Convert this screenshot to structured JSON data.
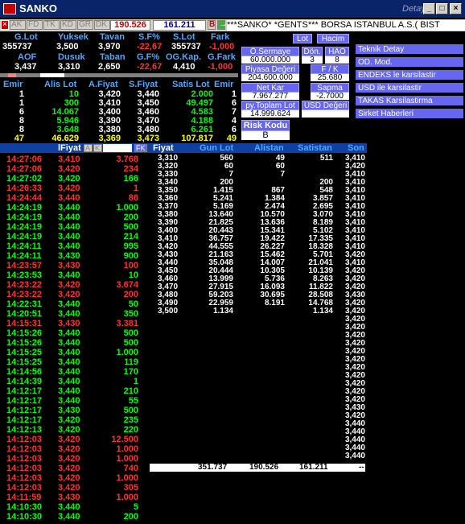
{
  "title": "SANKO",
  "detay": "Detay",
  "toolbar": {
    "tabs": [
      "AK",
      "FD",
      "TK",
      "KD",
      "GR",
      "DK"
    ],
    "price1": "190.526",
    "price2": "161.211",
    "b": "B",
    "ticker": "***SANKO* *GENTS*** BORSA ISTANBUL A.S.( BIST"
  },
  "top": {
    "h1": [
      "G.Lot",
      "Yuksek",
      "Tavan",
      "S.F%",
      "S.Lot",
      "Fark"
    ],
    "v1": [
      "355737",
      "3,500",
      "3,970",
      "-22,67",
      "355737",
      "-1,000"
    ],
    "h2": [
      "AOF",
      "Dusuk",
      "Taban",
      "G.F%",
      "OG.Kap.",
      "G.Fark"
    ],
    "v2": [
      "3,437",
      "3,310",
      "2,650",
      "-22,67",
      "4,410",
      "-1,000"
    ]
  },
  "panel": {
    "lot": "Lot",
    "hacim": "Hacim",
    "osermaye": "Ö.Sermaye",
    "osermaye_v": "60.000.000",
    "don": "Dön.",
    "don_v": "3",
    "hao": "HAO",
    "hao_v": "8",
    "piyasa": "Piyasa Değeri",
    "piyasa_v": "204.600.000",
    "fk": "F / K",
    "fk_v": "25.680",
    "netkar": "Net Kar",
    "netkar_v": "7.967.277",
    "sapma": "Sapma",
    "sapma_v": "-2.7000",
    "pytoplam": "py.Toplam Lot",
    "pytoplam_v": "14.999.624",
    "usd": "USD Değeri",
    "usd_v": "",
    "risk": "Risk Kodu",
    "risk_v": "B"
  },
  "side": [
    "Teknik Detay",
    "OD. Mod.",
    "ENDEKS le karsilastir",
    "USD ile karsilastir",
    "TAKAS Karsilastirma",
    "Sirket Haberleri"
  ],
  "depth": {
    "headers": [
      "Emir",
      "Alis Lot",
      "A.Fiyat",
      "S.Fiyat",
      "Satis Lot",
      "Emir"
    ],
    "rows": [
      [
        "1",
        "10",
        "3,420",
        "3,440",
        "2.000",
        "1"
      ],
      [
        "1",
        "300",
        "3,410",
        "3,450",
        "49.497",
        "6"
      ],
      [
        "6",
        "14.067",
        "3,400",
        "3,460",
        "4.583",
        "7"
      ],
      [
        "8",
        "5.946",
        "3,390",
        "3,470",
        "4.188",
        "4"
      ],
      [
        "8",
        "3.648",
        "3,380",
        "3,480",
        "6.261",
        "6"
      ],
      [
        "47",
        "46.629",
        "3,369",
        "3,473",
        "107.817",
        "49"
      ]
    ]
  },
  "trades": {
    "header": "lFiyat",
    "ak": "A",
    "kk": "K",
    "fk": "FK",
    "rows": [
      [
        "14:27:06",
        "3,410",
        "3.768",
        "r"
      ],
      [
        "14:27:06",
        "3,420",
        "234",
        "r"
      ],
      [
        "14:27:02",
        "3,420",
        "166",
        "g"
      ],
      [
        "14:26:33",
        "3,420",
        "1",
        "r"
      ],
      [
        "14:24:44",
        "3,440",
        "86",
        "r"
      ],
      [
        "14:24:19",
        "3,440",
        "1.000",
        "g"
      ],
      [
        "14:24:19",
        "3,440",
        "200",
        "g"
      ],
      [
        "14:24:19",
        "3,440",
        "500",
        "g"
      ],
      [
        "14:24:19",
        "3,440",
        "214",
        "g"
      ],
      [
        "14:24:11",
        "3,440",
        "995",
        "g"
      ],
      [
        "14:24:11",
        "3,430",
        "900",
        "g"
      ],
      [
        "14:23:57",
        "3,430",
        "100",
        "r"
      ],
      [
        "14:23:53",
        "3,440",
        "10",
        "g"
      ],
      [
        "14:23:22",
        "3,420",
        "3.674",
        "r"
      ],
      [
        "14:23:22",
        "3,420",
        "200",
        "r"
      ],
      [
        "14:22:31",
        "3,440",
        "50",
        "g"
      ],
      [
        "14:20:51",
        "3,440",
        "350",
        "g"
      ],
      [
        "14:15:31",
        "3,430",
        "3.381",
        "r"
      ],
      [
        "14:15:26",
        "3,440",
        "500",
        "g"
      ],
      [
        "14:15:26",
        "3,440",
        "500",
        "g"
      ],
      [
        "14:15:25",
        "3,440",
        "1.000",
        "g"
      ],
      [
        "14:15:25",
        "3,440",
        "119",
        "g"
      ],
      [
        "14:14:56",
        "3,440",
        "170",
        "g"
      ],
      [
        "14:14:39",
        "3,440",
        "1",
        "g"
      ],
      [
        "14:12:17",
        "3,440",
        "210",
        "g"
      ],
      [
        "14:12:17",
        "3,440",
        "55",
        "g"
      ],
      [
        "14:12:17",
        "3,430",
        "500",
        "g"
      ],
      [
        "14:12:17",
        "3,420",
        "235",
        "g"
      ],
      [
        "14:12:13",
        "3,420",
        "220",
        "g"
      ],
      [
        "14:12:03",
        "3,420",
        "12.500",
        "r"
      ],
      [
        "14:12:03",
        "3,420",
        "1.000",
        "r"
      ],
      [
        "14:12:03",
        "3,420",
        "1.000",
        "r"
      ],
      [
        "14:12:03",
        "3,420",
        "740",
        "r"
      ],
      [
        "14:12:03",
        "3,420",
        "1.000",
        "r"
      ],
      [
        "14:12:03",
        "3,420",
        "305",
        "r"
      ],
      [
        "14:11:59",
        "3,430",
        "1.000",
        "r"
      ],
      [
        "14:10:30",
        "3,440",
        "5",
        "g"
      ],
      [
        "14:10:30",
        "3,440",
        "200",
        "g"
      ]
    ]
  },
  "dist": {
    "headers": [
      "Fiyat",
      "Gun Lot",
      "Alistan",
      "Satistan",
      "Son"
    ],
    "rows": [
      [
        "3,310",
        "560",
        "49",
        "511"
      ],
      [
        "3,320",
        "60",
        "60",
        ""
      ],
      [
        "3,330",
        "7",
        "7",
        ""
      ],
      [
        "3,340",
        "200",
        "",
        "200"
      ],
      [
        "3,350",
        "1.415",
        "867",
        "548"
      ],
      [
        "3,360",
        "5.241",
        "1.384",
        "3.857"
      ],
      [
        "3,370",
        "5.169",
        "2.474",
        "2.695"
      ],
      [
        "3,380",
        "13.640",
        "10.570",
        "3.070"
      ],
      [
        "3,390",
        "21.825",
        "13.636",
        "8.189"
      ],
      [
        "3,400",
        "20.443",
        "15.341",
        "5.102"
      ],
      [
        "3,410",
        "36.757",
        "19.422",
        "17.335"
      ],
      [
        "3,420",
        "44.555",
        "26.227",
        "18.328"
      ],
      [
        "3,430",
        "21.163",
        "15.462",
        "5.701"
      ],
      [
        "3,440",
        "35.048",
        "14.007",
        "21.041"
      ],
      [
        "3,450",
        "20.444",
        "10.305",
        "10.139"
      ],
      [
        "3,460",
        "13.999",
        "5.736",
        "8.263"
      ],
      [
        "3,470",
        "27.915",
        "16.093",
        "11.822"
      ],
      [
        "3,480",
        "59.203",
        "30.695",
        "28.508"
      ],
      [
        "3,490",
        "22.959",
        "8.191",
        "14.768"
      ],
      [
        "3,500",
        "1.134",
        "",
        "1.134"
      ]
    ],
    "son": [
      "3,410",
      "3,420",
      "3,410",
      "3,410",
      "3,410",
      "3,410",
      "3,410",
      "3,410",
      "3,410",
      "3,410",
      "3,410",
      "3,410",
      "3,420",
      "3,410",
      "3,420",
      "3,420",
      "3,420",
      "3,430",
      "3,420",
      "3,420",
      "3,420",
      "3,420",
      "3,420",
      "3,420",
      "3,420",
      "3,420",
      "3,420",
      "3,420",
      "3,420",
      "3,420",
      "3,420",
      "3,430",
      "3,420",
      "3,440",
      "3,440",
      "3,440",
      "3,440",
      "3,440"
    ],
    "totals": [
      "351.737",
      "190.526",
      "161.211",
      "--"
    ]
  }
}
